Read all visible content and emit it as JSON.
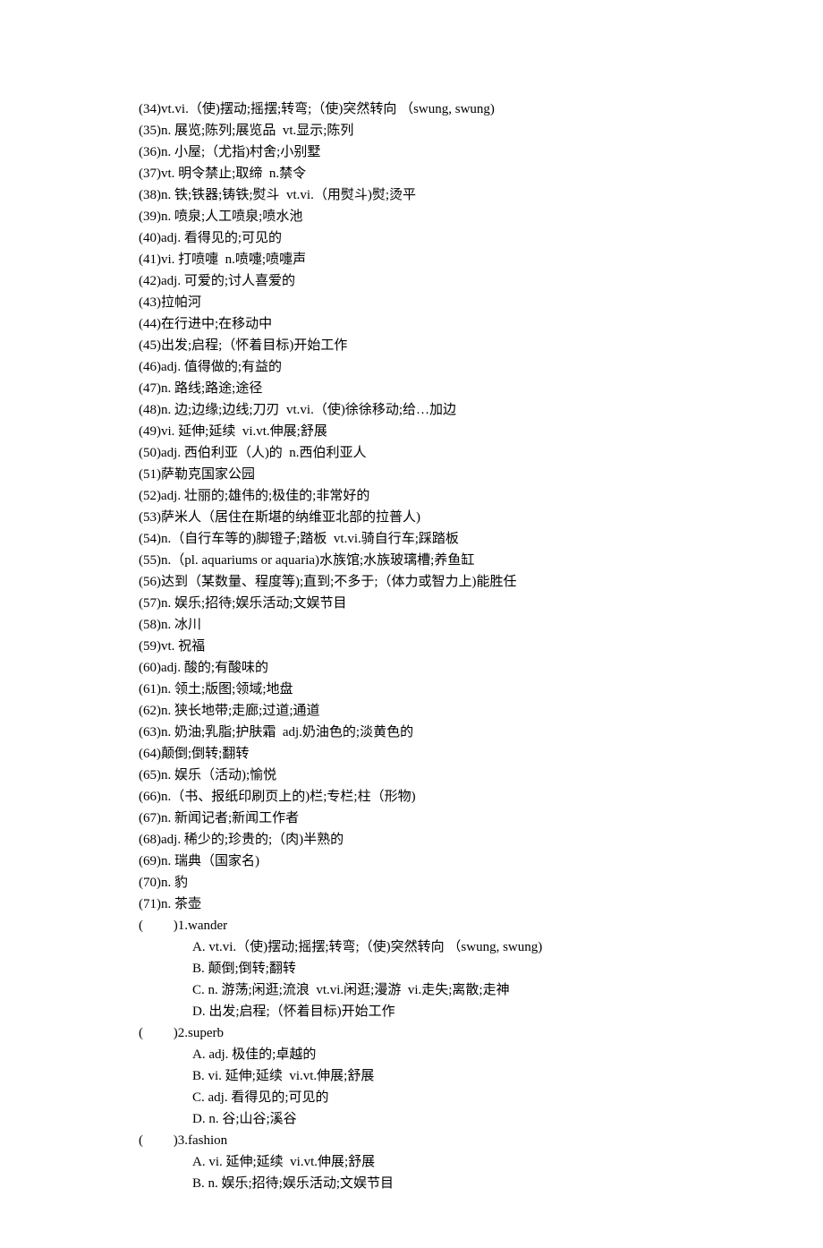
{
  "definitions": [
    "(34)vt.vi.（使)摆动;摇摆;转弯;（使)突然转向 （swung, swung)",
    "(35)n. 展览;陈列;展览品  vt.显示;陈列",
    "(36)n. 小屋;（尤指)村舍;小别墅",
    "(37)vt. 明令禁止;取缔  n.禁令",
    "(38)n. 铁;铁器;铸铁;熨斗  vt.vi.（用熨斗)熨;烫平",
    "(39)n. 喷泉;人工喷泉;喷水池",
    "(40)adj. 看得见的;可见的",
    "(41)vi. 打喷嚏  n.喷嚏;喷嚏声",
    "(42)adj. 可爱的;讨人喜爱的",
    "(43)拉帕河",
    "(44)在行进中;在移动中",
    "(45)出发;启程;（怀着目标)开始工作",
    "(46)adj. 值得做的;有益的",
    "(47)n. 路线;路途;途径",
    "(48)n. 边;边缘;边线;刀刃  vt.vi.（使)徐徐移动;给…加边",
    "(49)vi. 延伸;延续  vi.vt.伸展;舒展",
    "(50)adj. 西伯利亚（人)的  n.西伯利亚人",
    "(51)萨勒克国家公园",
    "(52)adj. 壮丽的;雄伟的;极佳的;非常好的",
    "(53)萨米人（居住在斯堪的纳维亚北部的拉普人)",
    "(54)n.（自行车等的)脚镫子;踏板  vt.vi.骑自行车;踩踏板",
    "(55)n.（pl. aquariums or aquaria)水族馆;水族玻璃槽;养鱼缸",
    "(56)达到（某数量、程度等);直到;不多于;（体力或智力上)能胜任",
    "(57)n. 娱乐;招待;娱乐活动;文娱节目",
    "(58)n. 冰川",
    "(59)vt. 祝福",
    "(60)adj. 酸的;有酸味的",
    "(61)n. 领土;版图;领域;地盘",
    "(62)n. 狭长地带;走廊;过道;通道",
    "(63)n. 奶油;乳脂;护肤霜  adj.奶油色的;淡黄色的",
    "(64)颠倒;倒转;翻转",
    "(65)n. 娱乐（活动);愉悦",
    "(66)n.（书、报纸印刷页上的)栏;专栏;柱（形物)",
    "(67)n. 新闻记者;新闻工作者",
    "(68)adj. 稀少的;珍贵的;（肉)半熟的",
    "(69)n. 瑞典（国家名)",
    "(70)n. 豹",
    "(71)n. 茶壶"
  ],
  "questions": [
    {
      "prefix": "(         )1.wander",
      "options": [
        "A. vt.vi.（使)摆动;摇摆;转弯;（使)突然转向 （swung, swung)",
        "B. 颠倒;倒转;翻转",
        "C. n. 游荡;闲逛;流浪  vt.vi.闲逛;漫游  vi.走失;离散;走神",
        "D. 出发;启程;（怀着目标)开始工作"
      ]
    },
    {
      "prefix": "(         )2.superb",
      "options": [
        "A. adj. 极佳的;卓越的",
        "B. vi. 延伸;延续  vi.vt.伸展;舒展",
        "C. adj. 看得见的;可见的",
        "D. n. 谷;山谷;溪谷"
      ]
    },
    {
      "prefix": "(         )3.fashion",
      "options": [
        "A. vi. 延伸;延续  vi.vt.伸展;舒展",
        "B. n. 娱乐;招待;娱乐活动;文娱节目"
      ]
    }
  ]
}
